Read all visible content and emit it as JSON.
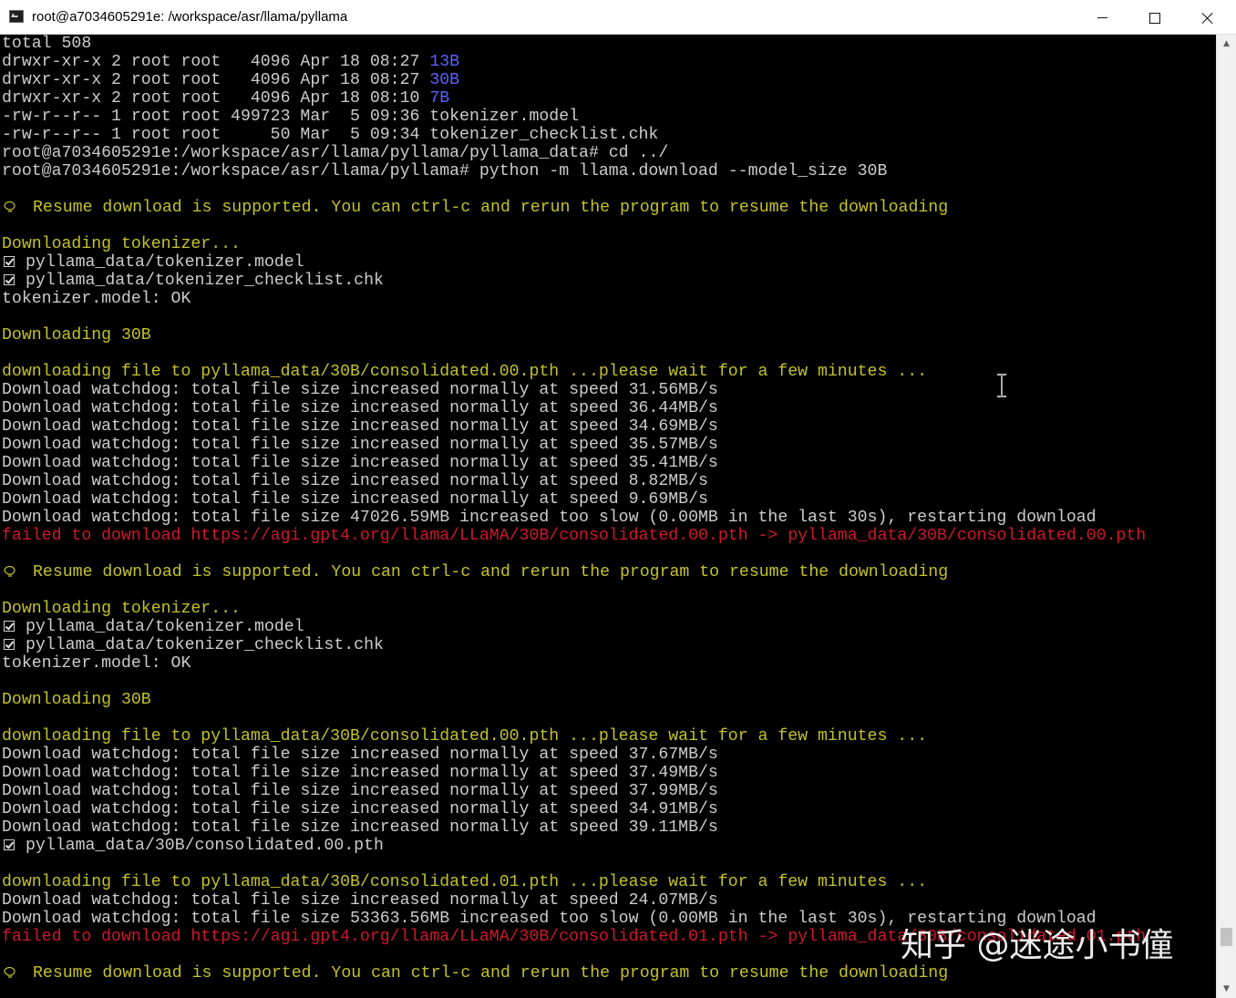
{
  "window": {
    "title": "root@a7034605291e: /workspace/asr/llama/pyllama",
    "icon": "terminal-icon",
    "controls": {
      "minimize": "minimize-icon",
      "maximize": "maximize-icon",
      "close": "close-icon"
    }
  },
  "colors": {
    "background": "#000000",
    "default_text": "#cccccc",
    "yellow_text": "#c3c22a",
    "red_text": "#d0182b",
    "blue_dir": "#5a63ff"
  },
  "terminal": {
    "lines": [
      {
        "parts": [
          {
            "t": "total 508",
            "c": "def"
          }
        ]
      },
      {
        "parts": [
          {
            "t": "drwxr-xr-x 2 root root   4096 Apr 18 08:27 ",
            "c": "def"
          },
          {
            "t": "13B",
            "c": "blue"
          }
        ]
      },
      {
        "parts": [
          {
            "t": "drwxr-xr-x 2 root root   4096 Apr 18 08:27 ",
            "c": "def"
          },
          {
            "t": "30B",
            "c": "blue"
          }
        ]
      },
      {
        "parts": [
          {
            "t": "drwxr-xr-x 2 root root   4096 Apr 18 08:10 ",
            "c": "def"
          },
          {
            "t": "7B",
            "c": "blue"
          }
        ]
      },
      {
        "parts": [
          {
            "t": "-rw-r--r-- 1 root root 499723 Mar  5 09:36 tokenizer.model",
            "c": "def"
          }
        ]
      },
      {
        "parts": [
          {
            "t": "-rw-r--r-- 1 root root     50 Mar  5 09:34 tokenizer_checklist.chk",
            "c": "def"
          }
        ]
      },
      {
        "parts": [
          {
            "t": "root@a7034605291e:/workspace/asr/llama/pyllama/pyllama_data# cd ../",
            "c": "def"
          }
        ]
      },
      {
        "parts": [
          {
            "t": "root@a7034605291e:/workspace/asr/llama/pyllama# python -m llama.download --model_size 30B",
            "c": "def"
          }
        ]
      },
      {
        "parts": []
      },
      {
        "icon": "lightbulb-icon",
        "parts": [
          {
            "t": "Resume download is supported. You can ctrl-c and rerun the program to resume the downloading",
            "c": "yel"
          }
        ]
      },
      {
        "parts": []
      },
      {
        "parts": [
          {
            "t": "Downloading tokenizer...",
            "c": "yel"
          }
        ]
      },
      {
        "icon": "checkbox-icon",
        "parts": [
          {
            "t": "pyllama_data/tokenizer.model",
            "c": "def"
          }
        ]
      },
      {
        "icon": "checkbox-icon",
        "parts": [
          {
            "t": "pyllama_data/tokenizer_checklist.chk",
            "c": "def"
          }
        ]
      },
      {
        "parts": [
          {
            "t": "tokenizer.model: OK",
            "c": "def"
          }
        ]
      },
      {
        "parts": []
      },
      {
        "parts": [
          {
            "t": "Downloading 30B",
            "c": "yel"
          }
        ]
      },
      {
        "parts": []
      },
      {
        "parts": [
          {
            "t": "downloading file to pyllama_data/30B/consolidated.00.pth ...please wait for a few minutes ...",
            "c": "yel"
          }
        ]
      },
      {
        "parts": [
          {
            "t": "Download watchdog: total file size increased normally at speed 31.56MB/s",
            "c": "def"
          }
        ]
      },
      {
        "parts": [
          {
            "t": "Download watchdog: total file size increased normally at speed 36.44MB/s",
            "c": "def"
          }
        ]
      },
      {
        "parts": [
          {
            "t": "Download watchdog: total file size increased normally at speed 34.69MB/s",
            "c": "def"
          }
        ]
      },
      {
        "parts": [
          {
            "t": "Download watchdog: total file size increased normally at speed 35.57MB/s",
            "c": "def"
          }
        ]
      },
      {
        "parts": [
          {
            "t": "Download watchdog: total file size increased normally at speed 35.41MB/s",
            "c": "def"
          }
        ]
      },
      {
        "parts": [
          {
            "t": "Download watchdog: total file size increased normally at speed 8.82MB/s",
            "c": "def"
          }
        ]
      },
      {
        "parts": [
          {
            "t": "Download watchdog: total file size increased normally at speed 9.69MB/s",
            "c": "def"
          }
        ]
      },
      {
        "parts": [
          {
            "t": "Download watchdog: total file size 47026.59MB increased too slow (0.00MB in the last 30s), restarting download",
            "c": "def"
          }
        ]
      },
      {
        "parts": [
          {
            "t": "failed to download https://agi.gpt4.org/llama/LLaMA/30B/consolidated.00.pth -> pyllama_data/30B/consolidated.00.pth",
            "c": "red"
          }
        ]
      },
      {
        "parts": []
      },
      {
        "icon": "lightbulb-icon",
        "parts": [
          {
            "t": "Resume download is supported. You can ctrl-c and rerun the program to resume the downloading",
            "c": "yel"
          }
        ]
      },
      {
        "parts": []
      },
      {
        "parts": [
          {
            "t": "Downloading tokenizer...",
            "c": "yel"
          }
        ]
      },
      {
        "icon": "checkbox-icon",
        "parts": [
          {
            "t": "pyllama_data/tokenizer.model",
            "c": "def"
          }
        ]
      },
      {
        "icon": "checkbox-icon",
        "parts": [
          {
            "t": "pyllama_data/tokenizer_checklist.chk",
            "c": "def"
          }
        ]
      },
      {
        "parts": [
          {
            "t": "tokenizer.model: OK",
            "c": "def"
          }
        ]
      },
      {
        "parts": []
      },
      {
        "parts": [
          {
            "t": "Downloading 30B",
            "c": "yel"
          }
        ]
      },
      {
        "parts": []
      },
      {
        "parts": [
          {
            "t": "downloading file to pyllama_data/30B/consolidated.00.pth ...please wait for a few minutes ...",
            "c": "yel"
          }
        ]
      },
      {
        "parts": [
          {
            "t": "Download watchdog: total file size increased normally at speed 37.67MB/s",
            "c": "def"
          }
        ]
      },
      {
        "parts": [
          {
            "t": "Download watchdog: total file size increased normally at speed 37.49MB/s",
            "c": "def"
          }
        ]
      },
      {
        "parts": [
          {
            "t": "Download watchdog: total file size increased normally at speed 37.99MB/s",
            "c": "def"
          }
        ]
      },
      {
        "parts": [
          {
            "t": "Download watchdog: total file size increased normally at speed 34.91MB/s",
            "c": "def"
          }
        ]
      },
      {
        "parts": [
          {
            "t": "Download watchdog: total file size increased normally at speed 39.11MB/s",
            "c": "def"
          }
        ]
      },
      {
        "icon": "checkbox-icon",
        "parts": [
          {
            "t": "pyllama_data/30B/consolidated.00.pth",
            "c": "def"
          }
        ]
      },
      {
        "parts": []
      },
      {
        "parts": [
          {
            "t": "downloading file to pyllama_data/30B/consolidated.01.pth ...please wait for a few minutes ...",
            "c": "yel"
          }
        ]
      },
      {
        "parts": [
          {
            "t": "Download watchdog: total file size increased normally at speed 24.07MB/s",
            "c": "def"
          }
        ]
      },
      {
        "parts": [
          {
            "t": "Download watchdog: total file size 53363.56MB increased too slow (0.00MB in the last 30s), restarting download",
            "c": "def"
          }
        ]
      },
      {
        "parts": [
          {
            "t": "failed to download https://agi.gpt4.org/llama/LLaMA/30B/consolidated.01.pth -> pyllama_data/30B/consolidated.01.pth",
            "c": "red"
          }
        ]
      },
      {
        "parts": []
      },
      {
        "icon": "lightbulb-icon",
        "parts": [
          {
            "t": "Resume download is supported. You can ctrl-c and rerun the program to resume the downloading",
            "c": "yel"
          }
        ]
      }
    ]
  },
  "scrollbar": {
    "up_arrow": "▲",
    "down_arrow": "▼"
  },
  "watermark": {
    "text": "知乎 @迷途小书僮"
  }
}
